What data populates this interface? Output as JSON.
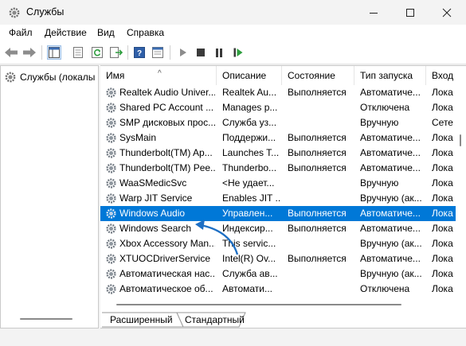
{
  "window": {
    "title": "Службы"
  },
  "menu": {
    "items": [
      {
        "label": "Файл"
      },
      {
        "label": "Действие"
      },
      {
        "label": "Вид"
      },
      {
        "label": "Справка"
      }
    ]
  },
  "tree": {
    "root_label": "Службы (локалы"
  },
  "table": {
    "headers": [
      "Имя",
      "Описание",
      "Состояние",
      "Тип запуска",
      "Вход"
    ],
    "rows": [
      {
        "name": "Realtek Audio Univer...",
        "description": "Realtek Au...",
        "status": "Выполняется",
        "startup": "Автоматиче...",
        "logon": "Лока"
      },
      {
        "name": "Shared PC Account ...",
        "description": "Manages p...",
        "status": "",
        "startup": "Отключена",
        "logon": "Лока"
      },
      {
        "name": "SMP дисковых прос...",
        "description": "Служба уз...",
        "status": "",
        "startup": "Вручную",
        "logon": "Сете"
      },
      {
        "name": "SysMain",
        "description": "Поддержи...",
        "status": "Выполняется",
        "startup": "Автоматиче...",
        "logon": "Лока"
      },
      {
        "name": "Thunderbolt(TM) Ap...",
        "description": "Launches T...",
        "status": "Выполняется",
        "startup": "Автоматиче...",
        "logon": "Лока"
      },
      {
        "name": "Thunderbolt(TM) Pee...",
        "description": "Thunderbo...",
        "status": "Выполняется",
        "startup": "Автоматиче...",
        "logon": "Лока"
      },
      {
        "name": "WaaSMedicSvc",
        "description": "<Не удает...",
        "status": "",
        "startup": "Вручную",
        "logon": "Лока"
      },
      {
        "name": "Warp JIT Service",
        "description": "Enables JIT ...",
        "status": "",
        "startup": "Вручную (ак...",
        "logon": "Лока"
      },
      {
        "name": "Windows Audio",
        "description": "Управлен...",
        "status": "Выполняется",
        "startup": "Автоматиче...",
        "logon": "Лока",
        "selected": true
      },
      {
        "name": "Windows Search",
        "description": "Индексир...",
        "status": "Выполняется",
        "startup": "Автоматиче...",
        "logon": "Лока"
      },
      {
        "name": "Xbox Accessory Man...",
        "description": "This servic...",
        "status": "",
        "startup": "Вручную (ак...",
        "logon": "Лока"
      },
      {
        "name": "XTUOCDriverService",
        "description": "Intel(R) Ov...",
        "status": "Выполняется",
        "startup": "Автоматиче...",
        "logon": "Лока"
      },
      {
        "name": "Автоматическая нас...",
        "description": "Служба ав...",
        "status": "",
        "startup": "Вручную (ак...",
        "logon": "Лока"
      },
      {
        "name": "Автоматическое об...",
        "description": "Автомати...",
        "status": "",
        "startup": "Отключена",
        "logon": "Лока"
      }
    ]
  },
  "tabs": [
    {
      "label": "Расширенный"
    },
    {
      "label": "Стандартный"
    }
  ],
  "colors": {
    "selection": "#0078d7",
    "annotation_arrow": "#1e6fc4"
  }
}
